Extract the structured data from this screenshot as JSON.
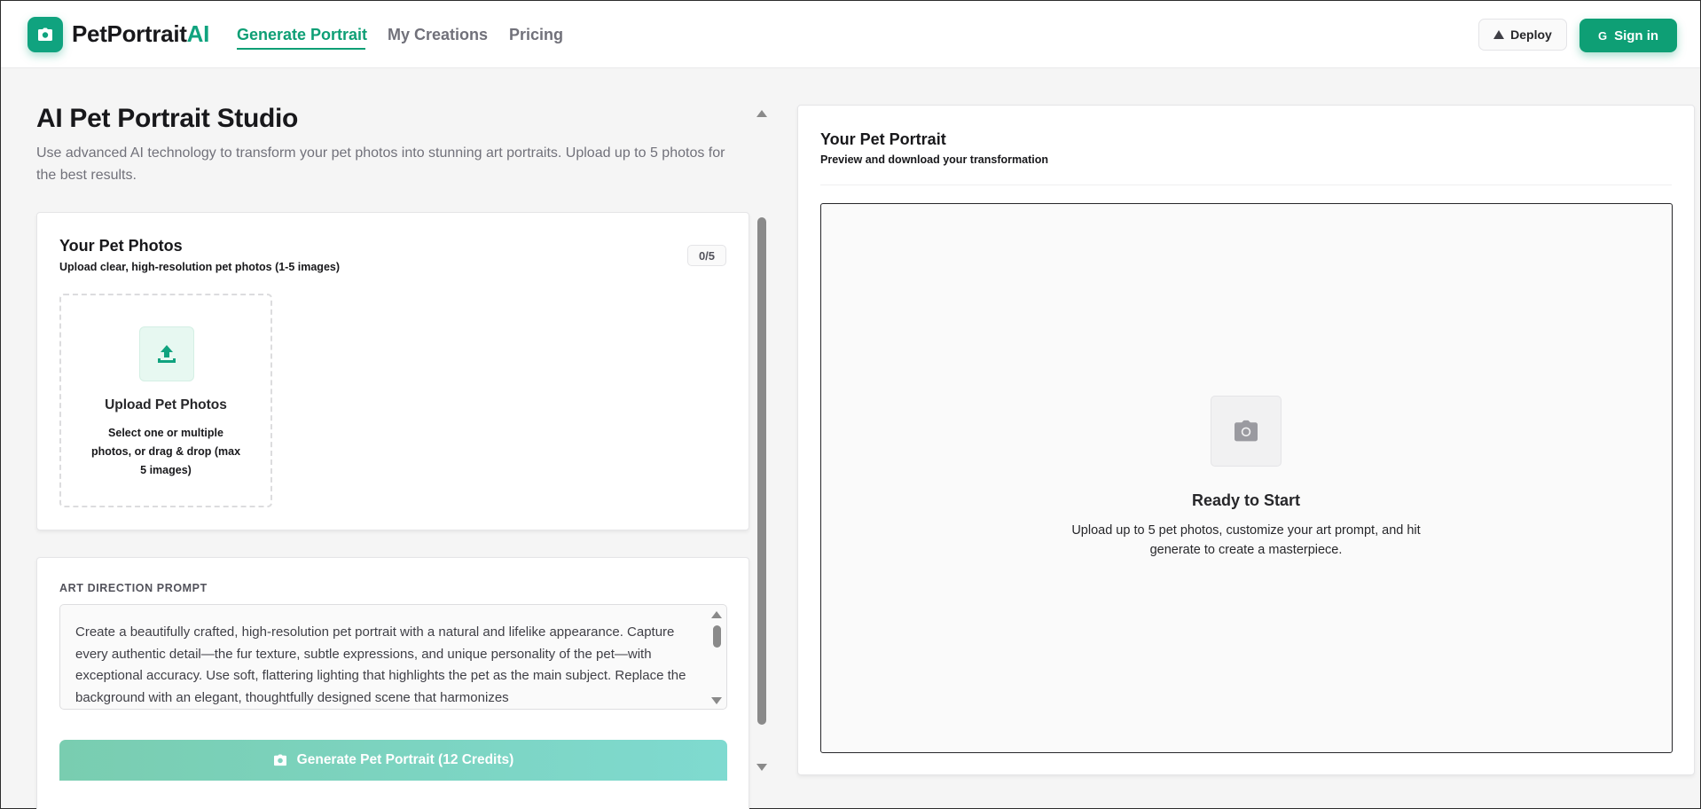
{
  "header": {
    "brand_main": "PetPortrait",
    "brand_accent": "AI",
    "nav": [
      {
        "label": "Generate Portrait",
        "active": true
      },
      {
        "label": "My Creations",
        "active": false
      },
      {
        "label": "Pricing",
        "active": false
      }
    ],
    "deploy_label": "Deploy",
    "signin_label": "Sign in",
    "signin_icon_letter": "G"
  },
  "studio": {
    "title": "AI Pet Portrait Studio",
    "description": "Use advanced AI technology to transform your pet photos into stunning art portraits. Upload up to 5 photos for the best results."
  },
  "photos_card": {
    "title": "Your Pet Photos",
    "subtitle": "Upload clear, high-resolution pet photos (1-5 images)",
    "count": "0/5",
    "dropzone_title": "Upload Pet Photos",
    "dropzone_subtitle": "Select one or multiple photos, or drag & drop (max 5 images)"
  },
  "prompt_card": {
    "label": "ART DIRECTION PROMPT",
    "text": "Create a beautifully crafted, high-resolution pet portrait with a natural and lifelike appearance. Capture every authentic detail—the fur texture, subtle expressions, and unique personality of the pet—with exceptional accuracy. Use soft, flattering lighting that highlights the pet as the main subject. Replace the background with an elegant, thoughtfully designed scene that harmonizes",
    "generate_label": "Generate Pet Portrait (12 Credits)"
  },
  "preview": {
    "title": "Your Pet Portrait",
    "subtitle": "Preview and download your transformation",
    "ready_title": "Ready to Start",
    "ready_text": "Upload up to 5 pet photos, customize your art prompt, and hit generate to create a masterpiece."
  },
  "colors": {
    "accent": "#0e9f75",
    "generate_gradient_start": "#79cdb0",
    "generate_gradient_end": "#7fdad0"
  },
  "icons": [
    "camera-icon",
    "triangle-icon",
    "upload-icon",
    "google-icon"
  ]
}
